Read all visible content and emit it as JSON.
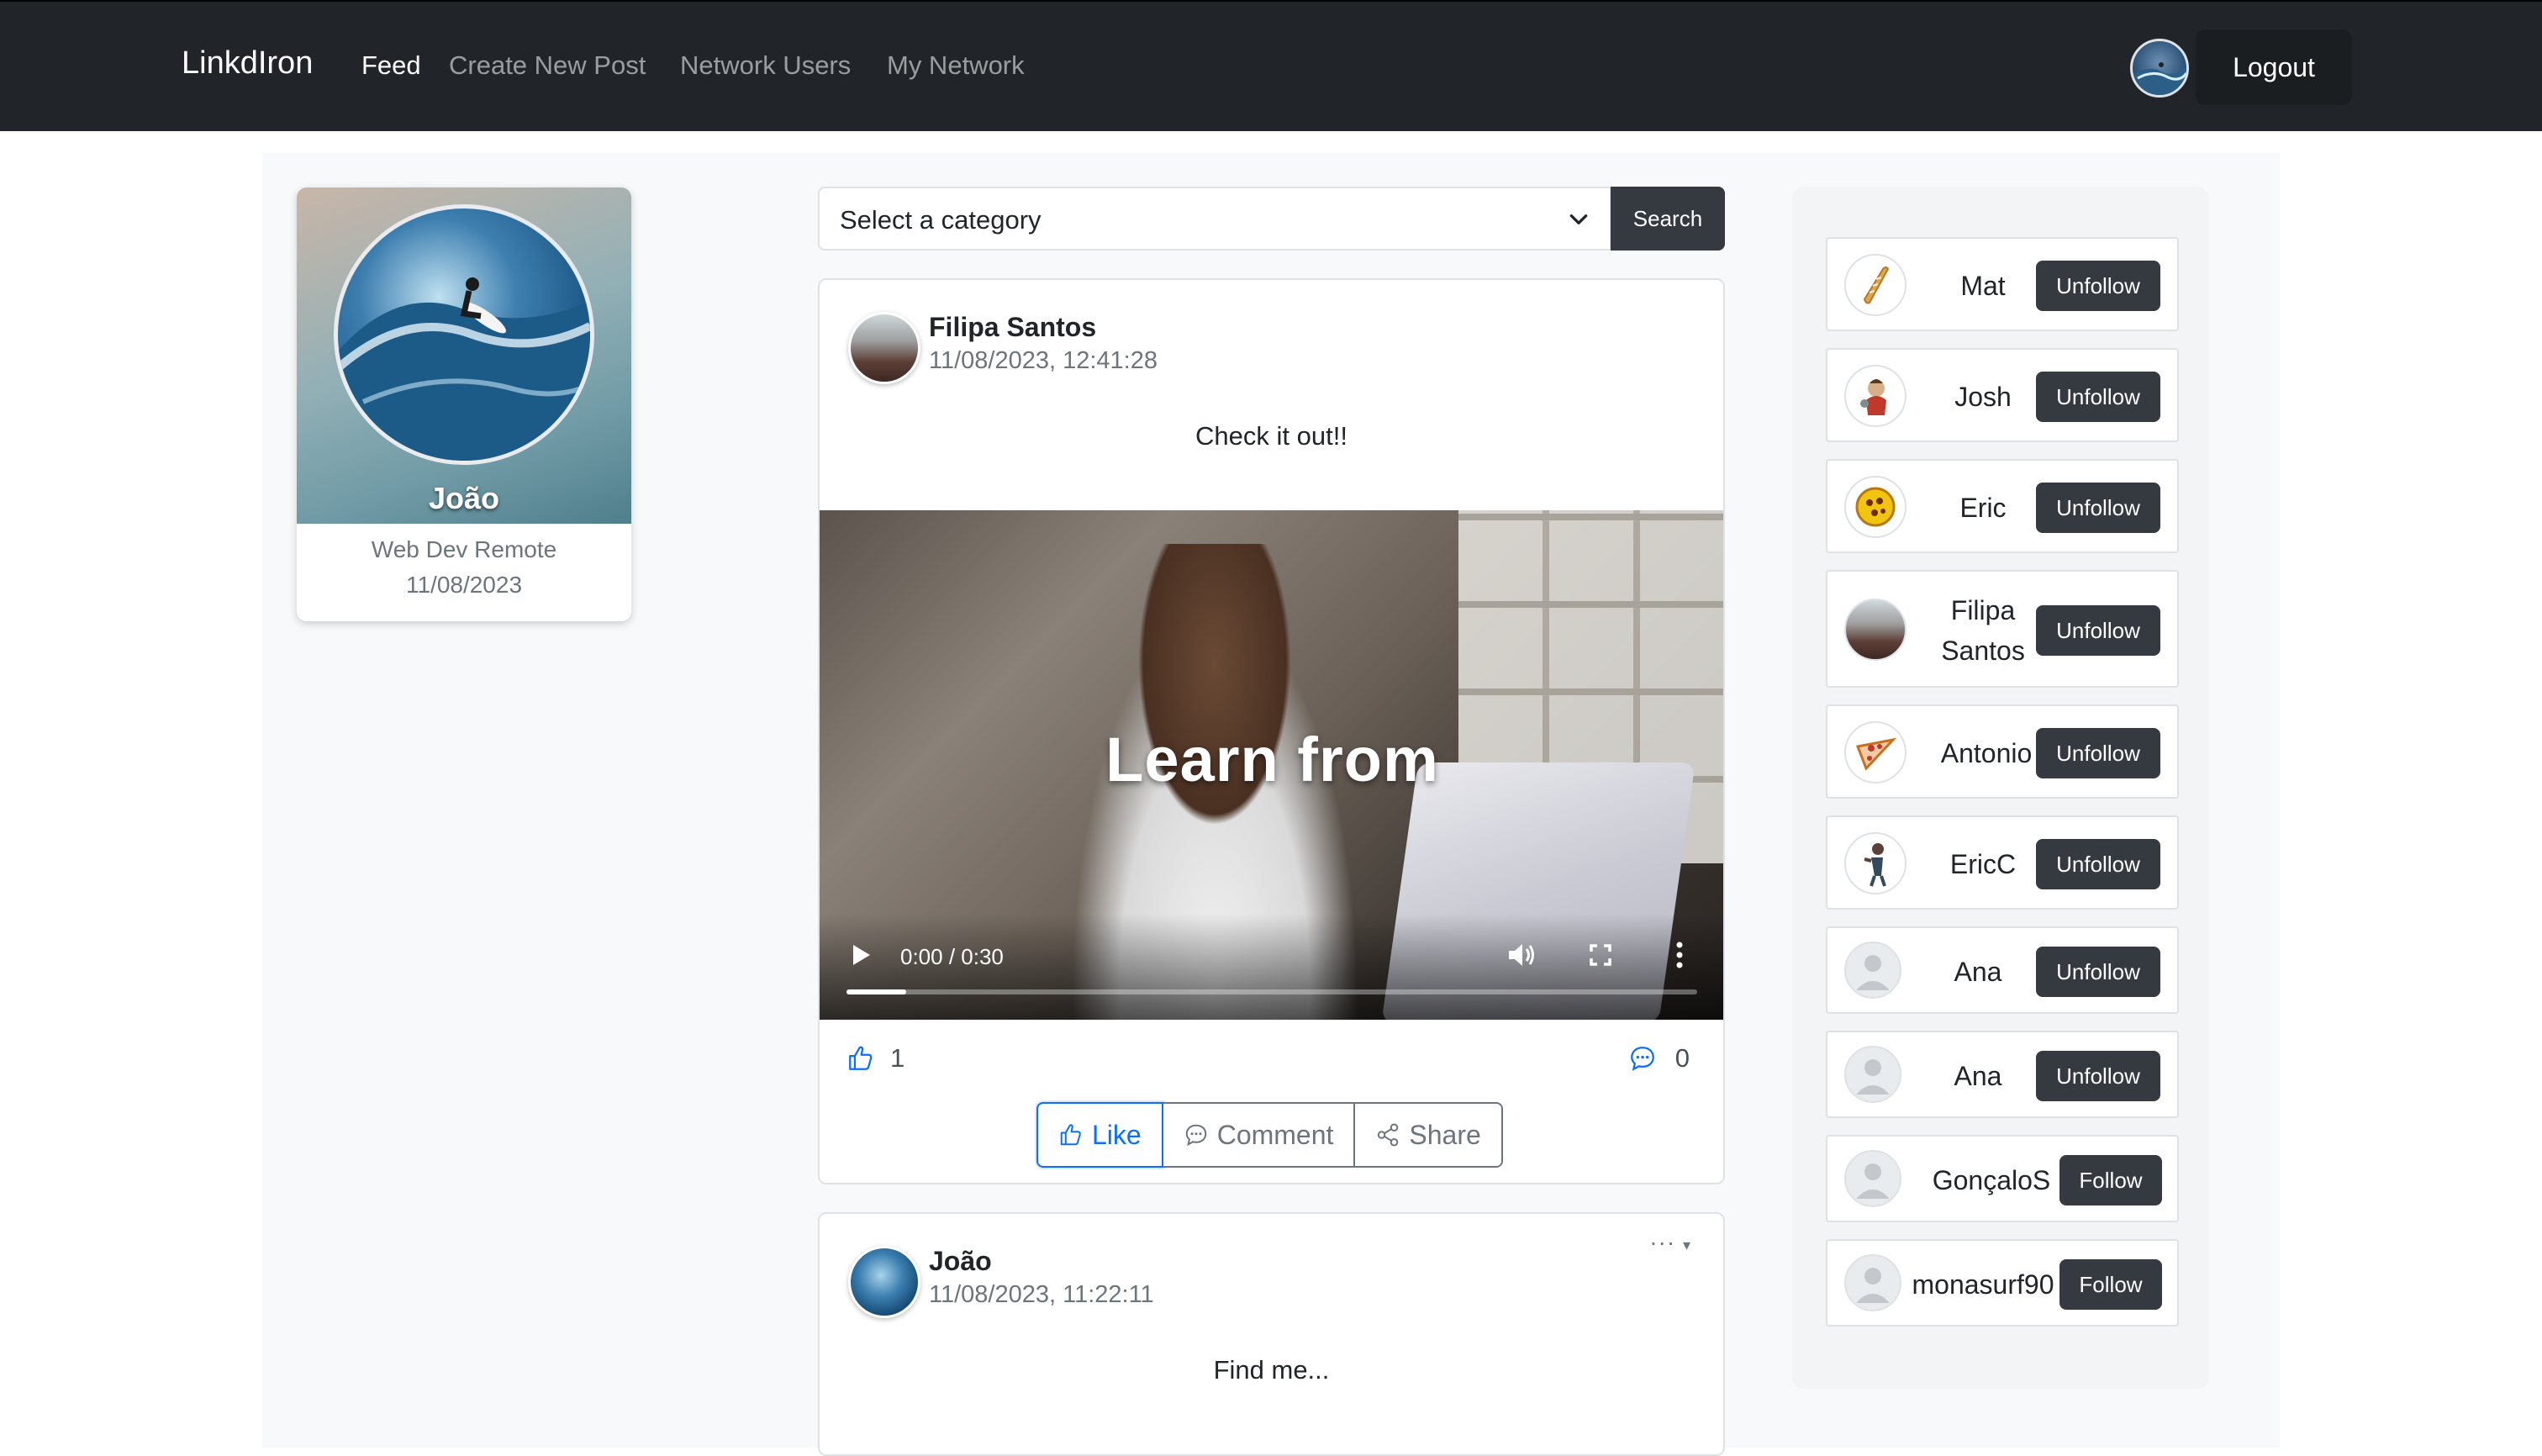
{
  "nav": {
    "brand": "LinkdIron",
    "links": [
      "Feed",
      "Create New Post",
      "Network Users",
      "My Network"
    ],
    "logout": "Logout"
  },
  "profile": {
    "name": "João",
    "title": "Web Dev Remote",
    "date": "11/08/2023"
  },
  "search": {
    "category_placeholder": "Select a category",
    "button": "Search"
  },
  "posts": [
    {
      "author": "Filipa Santos",
      "time": "11/08/2023, 12:41:28",
      "text": "Check it out!!",
      "video": {
        "caption": "Learn from",
        "time": "0:00 / 0:30",
        "progress": 0.07
      },
      "likes": "1",
      "comments": "0",
      "actions": [
        "Like",
        "Comment",
        "Share"
      ]
    },
    {
      "author": "João",
      "time": "11/08/2023, 11:22:11",
      "text": "Find me...",
      "menu": "···"
    }
  ],
  "network": [
    {
      "name": "Mat",
      "action": "Unfollow",
      "avatar": "baguette-icon"
    },
    {
      "name": "Josh",
      "action": "Unfollow",
      "avatar": "character-icon"
    },
    {
      "name": "Eric",
      "action": "Unfollow",
      "avatar": "pie-icon"
    },
    {
      "name": "Filipa Santos",
      "action": "Unfollow",
      "avatar": "photo"
    },
    {
      "name": "Antonio",
      "action": "Unfollow",
      "avatar": "pizza-icon"
    },
    {
      "name": "EricC",
      "action": "Unfollow",
      "avatar": "figure-icon"
    },
    {
      "name": "Ana",
      "action": "Unfollow",
      "avatar": "default-user-icon"
    },
    {
      "name": "Ana",
      "action": "Unfollow",
      "avatar": "default-user-icon"
    },
    {
      "name": "GonçaloS",
      "action": "Follow",
      "avatar": "default-user-icon"
    },
    {
      "name": "monasurf90",
      "action": "Follow",
      "avatar": "default-user-icon"
    }
  ]
}
